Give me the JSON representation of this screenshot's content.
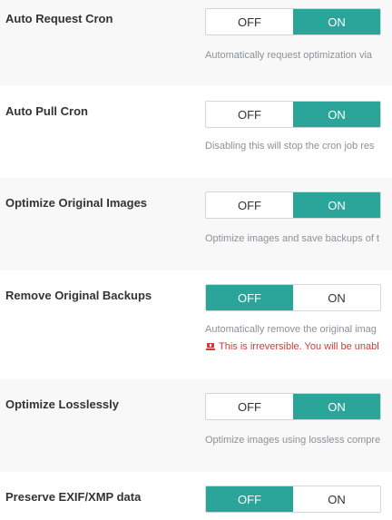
{
  "settings": [
    {
      "label": "Auto Request Cron",
      "off_label": "OFF",
      "on_label": "ON",
      "state": "on",
      "description": "Automatically request optimization via"
    },
    {
      "label": "Auto Pull Cron",
      "off_label": "OFF",
      "on_label": "ON",
      "state": "on",
      "description": "Disabling this will stop the cron job res"
    },
    {
      "label": "Optimize Original Images",
      "off_label": "OFF",
      "on_label": "ON",
      "state": "on",
      "description": "Optimize images and save backups of t"
    },
    {
      "label": "Remove Original Backups",
      "off_label": "OFF",
      "on_label": "ON",
      "state": "off",
      "description": "Automatically remove the original imag",
      "warning": "This is irreversible. You will be unabl"
    },
    {
      "label": "Optimize Losslessly",
      "off_label": "OFF",
      "on_label": "ON",
      "state": "on",
      "description": "Optimize images using lossless compre"
    },
    {
      "label": "Preserve EXIF/XMP data",
      "off_label": "OFF",
      "on_label": "ON",
      "state": "off"
    }
  ],
  "colors": {
    "active": "#2ba59a",
    "warning": "#d43a3a",
    "description": "#8a9299"
  },
  "icons": {
    "warning": "alert-icon"
  }
}
